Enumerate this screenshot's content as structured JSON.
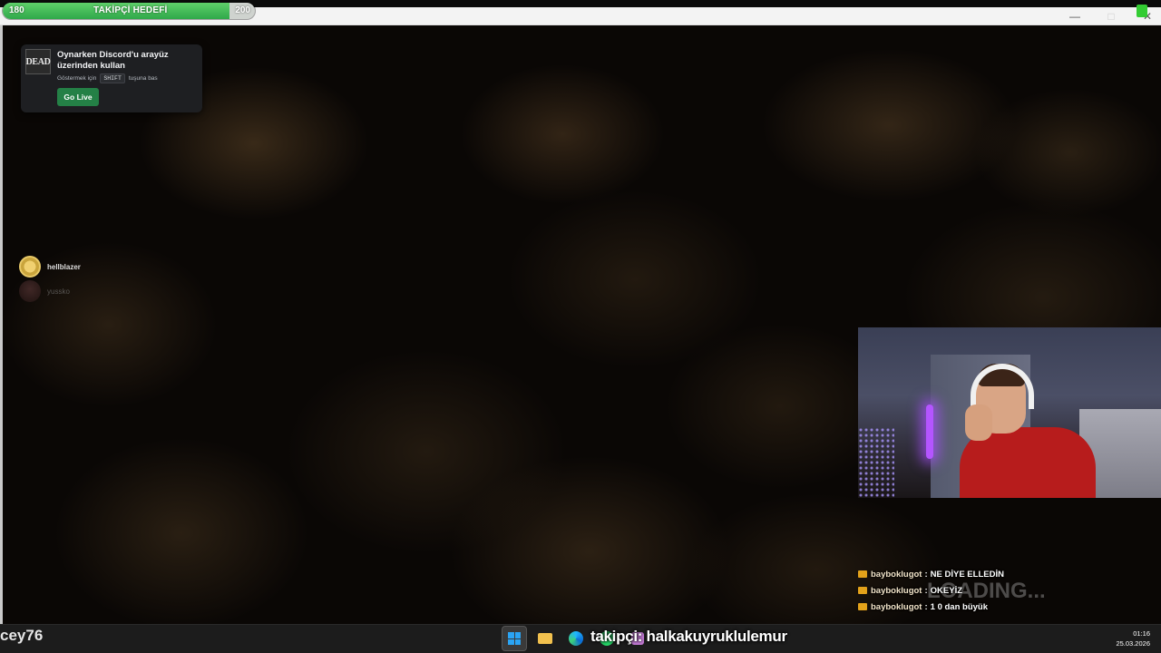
{
  "follower_goal": {
    "title": "TAKİPÇİ HEDEFİ",
    "current": "180",
    "target": "200",
    "progress": 0.9,
    "fill_color": "#3cba52"
  },
  "window": {
    "minimize_icon": "minimize-icon",
    "maximize_icon": "maximize-icon",
    "close_icon": "close-icon"
  },
  "discord_overlay": {
    "game_logo_text": "DEAD",
    "title": "Oynarken Discord'u arayüz üzerinden kullan",
    "hint_before": "Göstermek için",
    "hint_key": "SHIFT",
    "hint_after": "tuşuna bas",
    "go_live_label": "Go Live",
    "go_live_color": "#248046"
  },
  "voice_users": [
    {
      "name": "hellblazer"
    },
    {
      "name": "yussko"
    }
  ],
  "chat": {
    "badge_color": "#e3a21a",
    "messages": [
      {
        "user": "bayboklugot",
        "text": "NE DİYE ELLEDİN"
      },
      {
        "user": "bayboklugot",
        "text": "OKEYİZ"
      },
      {
        "user": "bayboklugot",
        "text": "1 0 dan büyük"
      }
    ],
    "watermark": "LOADING..."
  },
  "overlay_texts": {
    "viewer_name": "cey76",
    "follower_ticker": "takipçi: halkakuyruklulemur"
  },
  "taskbar": {
    "icons": [
      "windows-start-icon",
      "file-explorer-icon",
      "edge-browser-icon",
      "whatsapp-icon",
      "app-icon"
    ],
    "time": "01:16",
    "date": "25.03.2026"
  }
}
